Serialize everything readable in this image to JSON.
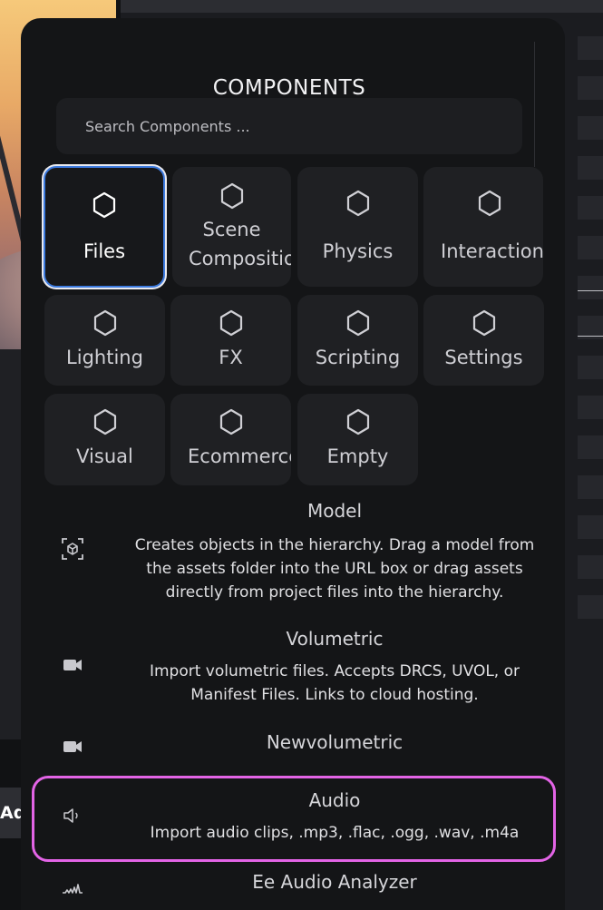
{
  "add_button": {
    "label": "Ad"
  },
  "panel": {
    "title": "COMPONENTS",
    "search": {
      "placeholder": "Search Components ...",
      "value": ""
    }
  },
  "categories": [
    {
      "label": "Files",
      "selected": true
    },
    {
      "label": "Scene Composition",
      "line1": "Scene",
      "line2": "Compositio"
    },
    {
      "label": "Physics"
    },
    {
      "label": "Interaction"
    },
    {
      "label": "Lighting"
    },
    {
      "label": "FX"
    },
    {
      "label": "Scripting"
    },
    {
      "label": "Settings"
    },
    {
      "label": "Visual"
    },
    {
      "label": "Ecommerce"
    },
    {
      "label": "Empty"
    }
  ],
  "items": [
    {
      "name": "Model",
      "icon": "3d-box-icon",
      "desc": [
        "Creates objects in the hierarchy. Drag a model from",
        "the assets folder into the URL box or drag assets",
        "directly from project files into the hierarchy."
      ]
    },
    {
      "name": "Volumetric",
      "icon": "video-camera-icon",
      "desc": [
        "Import volumetric files. Accepts DRCS, UVOL, or",
        "Manifest Files. Links to cloud hosting."
      ]
    },
    {
      "name": "Newvolumetric",
      "icon": "video-camera-icon",
      "desc": []
    },
    {
      "name": "Audio",
      "icon": "speaker-icon",
      "highlighted": true,
      "desc": [
        "Import audio clips, .mp3, .flac, .ogg, .wav, .m4a"
      ]
    },
    {
      "name": "Ee Audio Analyzer",
      "icon": "audio-waveform-icon",
      "desc": []
    }
  ],
  "colors": {
    "panel_bg": "#141517",
    "tile_bg": "#1f2023",
    "selected_border": "#3d7be0",
    "highlight_border": "#e364e6"
  }
}
